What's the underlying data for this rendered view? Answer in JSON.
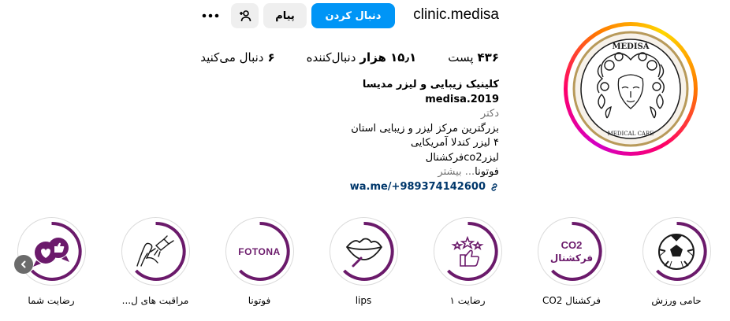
{
  "profile": {
    "username": "clinic.medisa",
    "follow_label": "دنبال کردن",
    "message_label": "پیام",
    "suggest_icon": "person-add-icon",
    "more_icon": "more-dots-icon"
  },
  "stats": [
    {
      "num": "۴۳۶",
      "label": "پست"
    },
    {
      "num": "۱۵٫۱ هزار",
      "label": "دنبال‌کننده"
    },
    {
      "num": "۶",
      "label": "دنبال می‌کنید"
    }
  ],
  "bio": {
    "full_name": "کلینیک زیبایی و لیزر مدیسا medisa.2019",
    "category": "دکتر",
    "lines": [
      "بزرگترین مرکز لیزر و زیبایی استان",
      "۴ لیزر کندلا آمریکایی",
      "لیزرco2فرکشنال"
    ],
    "last_line": "فوتونا",
    "more_label": "... بیشتر",
    "link": "wa.me/+989374142600"
  },
  "avatar": {
    "brand": "MEDISA",
    "subtitle": "MEDICAL CARE"
  },
  "highlights": [
    {
      "label": "حامی ورزش",
      "icon": "soccer-ball-icon"
    },
    {
      "label": "فرکشنال CO2",
      "icon": "co2-text",
      "line1": "CO2",
      "line2": "فرکشنال"
    },
    {
      "label": "رضایت ۱",
      "icon": "stars-thumbs-up-icon"
    },
    {
      "label": "lips",
      "icon": "lips-icon"
    },
    {
      "label": "فوتونا",
      "icon": "fotona-text",
      "text": "FOTONA"
    },
    {
      "label": "مراقبت های ل...",
      "icon": "laser-leg-icon"
    },
    {
      "label": "رضایت شما",
      "icon": "chat-likes-icon"
    }
  ],
  "colors": {
    "accent": "#0095f6",
    "highlight_purple": "#6b1a6b",
    "link": "#00376b"
  }
}
